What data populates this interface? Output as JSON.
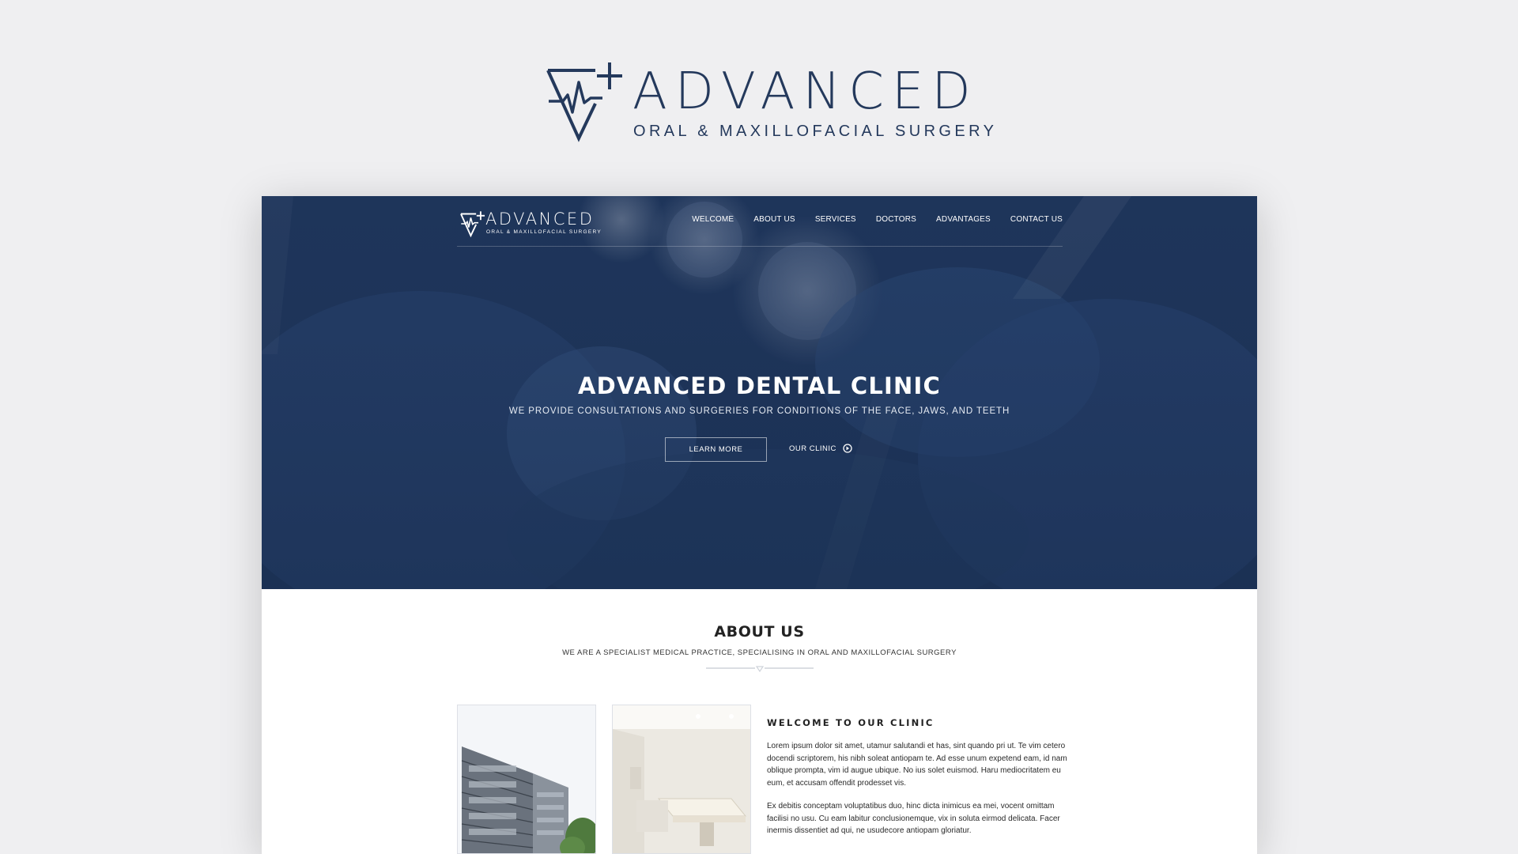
{
  "brand": {
    "wordmark": "ADVANCED",
    "tagline": "ORAL & MAXILLOFACIAL SURGERY",
    "color": "#24395c"
  },
  "site": {
    "nav": {
      "logo_wordmark": "ADVANCED",
      "logo_tagline": "ORAL & MAXILLOFACIAL SURGERY",
      "links": [
        "WELCOME",
        "ABOUT US",
        "SERVICES",
        "DOCTORS",
        "ADVANTAGES",
        "CONTACT US"
      ]
    },
    "hero": {
      "title": "ADVANCED DENTAL CLINIC",
      "subtitle": "WE PROVIDE CONSULTATIONS AND SURGERIES FOR CONDITIONS OF THE FACE, JAWS, AND TEETH",
      "primary_button": "LEARN MORE",
      "secondary_link": "OUR CLINIC",
      "secondary_icon": "arrow-circle-icon",
      "overlay_color": "#1d3358"
    },
    "about": {
      "title": "ABOUT US",
      "subtitle": "WE ARE A SPECIALIST MEDICAL PRACTICE, SPECIALISING IN ORAL AND MAXILLOFACIAL SURGERY",
      "welcome_heading": "WELCOME TO OUR CLINIC",
      "paragraphs": [
        "Lorem ipsum dolor sit amet, utamur salutandi et has, sint quando pri ut. Te vim cetero docendi scriptorem, his nibh soleat antiopam te. Ad esse unum expetend eam, id nam oblique prompta, vim id augue ubique. No ius solet euismod. Haru mediocritatem eu eum, et accusam offendit prodesset vis.",
        "Ex debitis conceptam voluptatibus duo, hinc dicta inimicus ea mei, vocent omittam facilisi no usu. Cu eam labitur conclusionemque, vix in soluta eirmod delicata. Facer inermis dissentiet ad qui, ne usudecore antiopam gloriatur."
      ]
    }
  }
}
